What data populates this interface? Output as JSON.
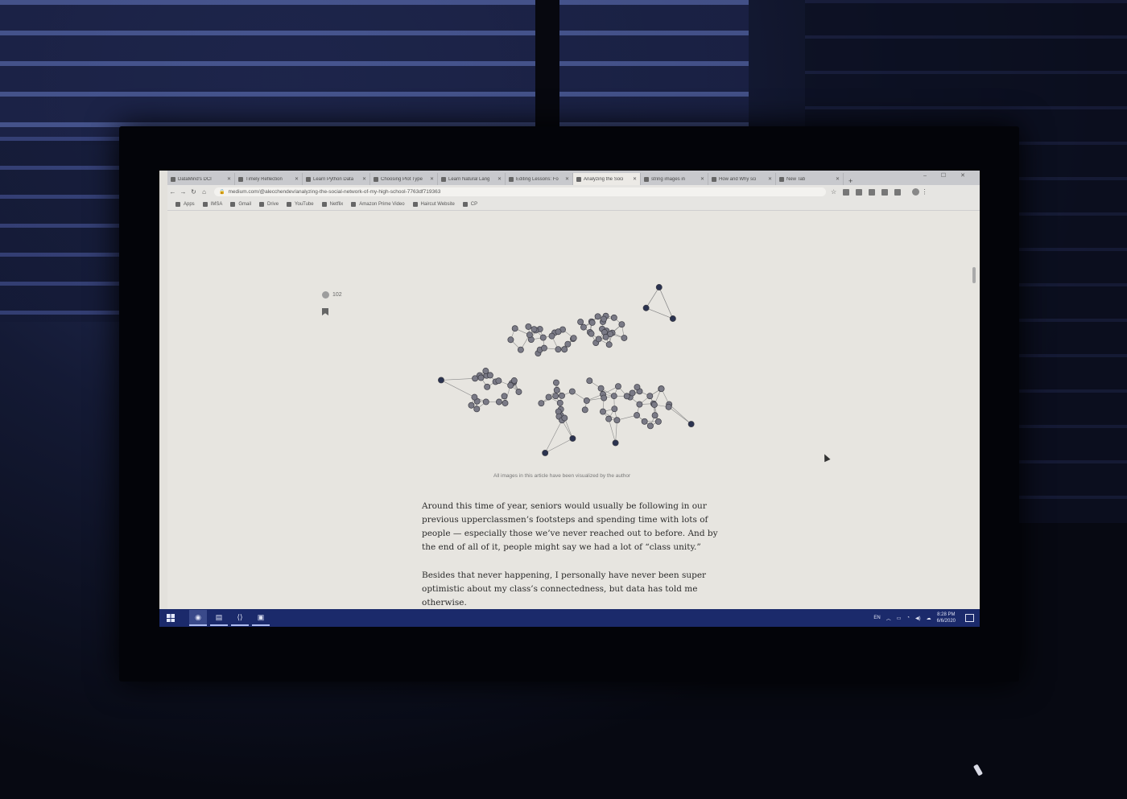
{
  "browser": {
    "tabs": [
      {
        "label": "DataMind's DCI"
      },
      {
        "label": "Timely Reflection"
      },
      {
        "label": "Learn Python Data"
      },
      {
        "label": "Choosing Plot Type"
      },
      {
        "label": "Learn Natural Lang"
      },
      {
        "label": "Editing Lessons: Fo"
      },
      {
        "label": "Analyzing the Soci"
      },
      {
        "label": "string images in"
      },
      {
        "label": "How and Why sci"
      },
      {
        "label": "New Tab"
      }
    ],
    "active_tab_index": 6,
    "new_tab_glyph": "+",
    "url": "medium.com/@alecchendev/analyzing-the-social-network-of-my-high-school-7763df719363",
    "bookmarks": [
      {
        "label": "Apps"
      },
      {
        "label": "IMSA"
      },
      {
        "label": "Gmail"
      },
      {
        "label": "Drive"
      },
      {
        "label": "YouTube"
      },
      {
        "label": "Netflix"
      },
      {
        "label": "Amazon Prime Video"
      },
      {
        "label": "Haircut Website"
      },
      {
        "label": "CP"
      }
    ]
  },
  "article": {
    "clap_count": "102",
    "caption": "All images in this article have been visualized by the author",
    "paragraph1": "Around this time of year, seniors would usually be following in our previous upperclassmen’s footsteps and spending time with lots of people — especially those we’ve never reached out to before. And by the end of all of it, people might say we had a lot of “class unity.”",
    "paragraph2": "Besides that never happening, I personally have never been super optimistic about my class’s connectedness, but data has told me otherwise."
  },
  "taskbar": {
    "language": "EN",
    "time": "8:28 PM",
    "date": "6/6/2020"
  },
  "colors": {
    "node_fill": "#7a7a86",
    "node_outer_fill": "#2b3350",
    "edge": "#8a8a8a",
    "taskbar": "#1b2a6b"
  }
}
